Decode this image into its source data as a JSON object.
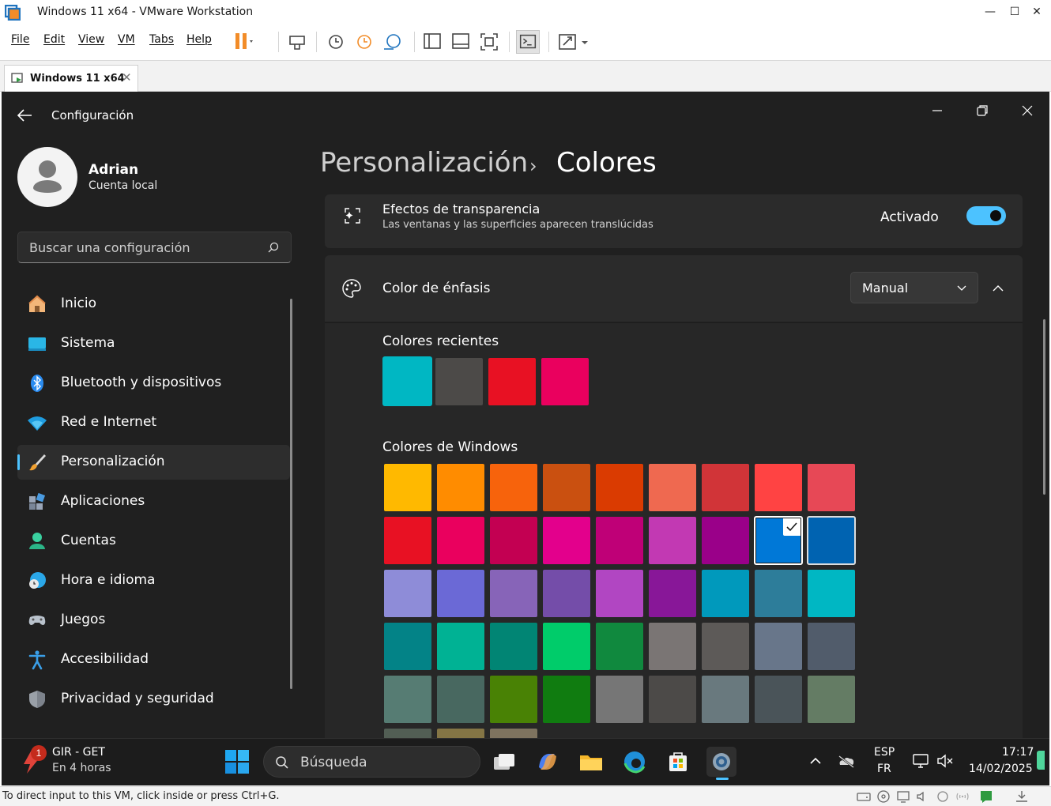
{
  "vmware": {
    "window_title": "Windows 11 x64 - VMware Workstation",
    "menu": [
      "File",
      "Edit",
      "View",
      "VM",
      "Tabs",
      "Help"
    ],
    "tab_label": "Windows 11 x64",
    "status_text": "To direct input to this VM, click inside or press Ctrl+G."
  },
  "settings": {
    "app_title": "Configuración",
    "profile": {
      "name": "Adrian",
      "account_type": "Cuenta local"
    },
    "search_placeholder": "Buscar una configuración",
    "nav": [
      {
        "label": "Inicio",
        "icon": "home-icon"
      },
      {
        "label": "Sistema",
        "icon": "system-icon"
      },
      {
        "label": "Bluetooth y dispositivos",
        "icon": "bluetooth-icon"
      },
      {
        "label": "Red e Internet",
        "icon": "wifi-icon"
      },
      {
        "label": "Personalización",
        "icon": "brush-icon",
        "active": true
      },
      {
        "label": "Aplicaciones",
        "icon": "apps-icon"
      },
      {
        "label": "Cuentas",
        "icon": "person-icon"
      },
      {
        "label": "Hora e idioma",
        "icon": "globe-clock-icon"
      },
      {
        "label": "Juegos",
        "icon": "gamepad-icon"
      },
      {
        "label": "Accesibilidad",
        "icon": "accessibility-icon"
      },
      {
        "label": "Privacidad y seguridad",
        "icon": "shield-icon"
      }
    ],
    "breadcrumb": {
      "parent": "Personalización",
      "separator": "›",
      "current": "Colores"
    },
    "transparency": {
      "title": "Efectos de transparencia",
      "description": "Las ventanas y las superficies aparecen translúcidas",
      "state_label": "Activado",
      "on": true
    },
    "accent": {
      "title": "Color de énfasis",
      "mode_value": "Manual",
      "recent_label": "Colores recientes",
      "windows_label": "Colores de Windows",
      "recent_colors": [
        "#00b7c3",
        "#4c4a48",
        "#e81123",
        "#ea005e"
      ],
      "windows_colors": [
        [
          "#ffb900",
          "#ff8c00",
          "#f7630c",
          "#ca5010",
          "#da3b01",
          "#ef6950",
          "#d13438",
          "#ff4343",
          "#e74856"
        ],
        [
          "#e81123",
          "#ea005e",
          "#c30052",
          "#e3008c",
          "#bf0077",
          "#c239b3",
          "#9a0089",
          "#0078d7",
          "#0063b1"
        ],
        [
          "#8e8cd8",
          "#6b69d6",
          "#8764b8",
          "#744da9",
          "#b146c2",
          "#881798",
          "#0099bc",
          "#2d7d9a",
          "#00b7c3"
        ],
        [
          "#038387",
          "#00b294",
          "#018574",
          "#00cc6a",
          "#10893e",
          "#7a7574",
          "#5d5a58",
          "#68768a",
          "#515c6b"
        ],
        [
          "#567c73",
          "#486860",
          "#498205",
          "#107c10",
          "#767676",
          "#4c4a48",
          "#69797e",
          "#4a5459",
          "#647c64"
        ],
        [
          "#525e54",
          "#847545",
          "#7e735f"
        ]
      ],
      "selected": {
        "row": 1,
        "col": 7
      }
    }
  },
  "taskbar": {
    "weather_badge": "1",
    "weather_title": "GIR - GET",
    "weather_sub": "En 4 horas",
    "search_text": "Búsqueda",
    "lang_top": "ESP",
    "lang_bottom": "FR",
    "time": "17:17",
    "date": "14/02/2025"
  }
}
